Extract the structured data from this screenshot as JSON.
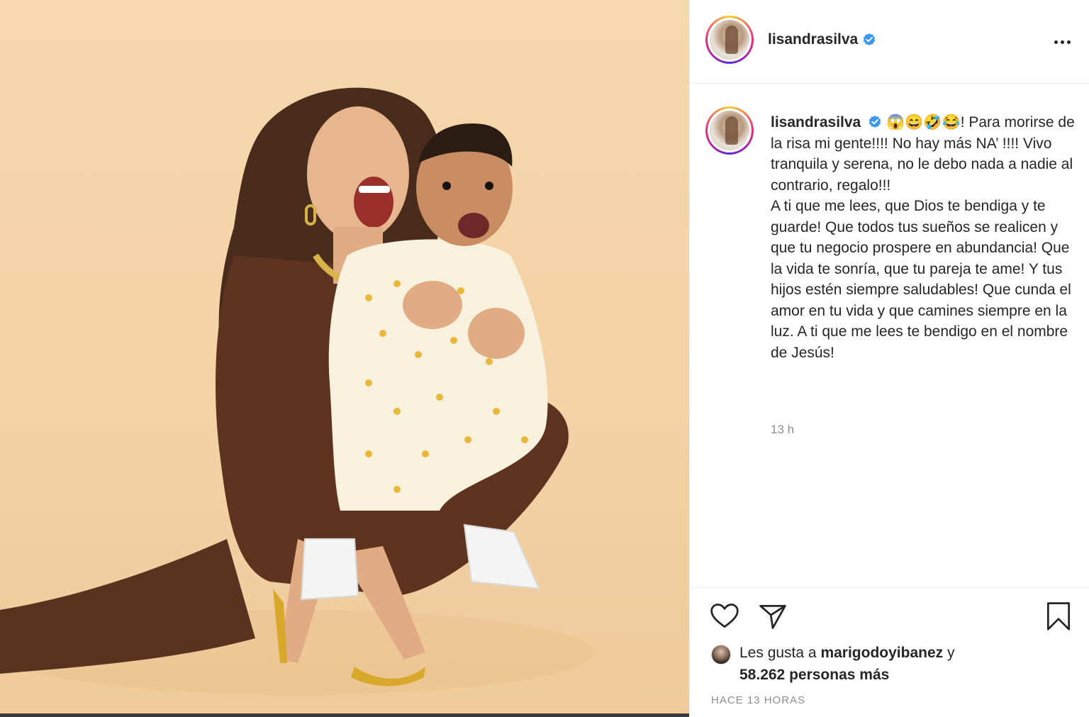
{
  "post": {
    "username": "lisandrasilva",
    "verified": true,
    "caption": {
      "emojis": "😱😄🤣😂",
      "paragraph1": "! Para morirse de la risa mi gente!!!! No hay más NA’ !!!! Vivo tranquila y serena, no le debo nada a nadie al contrario, regalo!!!",
      "paragraph2": "A ti que me lees, que Dios te bendiga y te guarde! Que todos tus sueños se realicen y que tu negocio prospere en abundancia! Que la vida te sonría, que tu pareja te ame! Y tus hijos estén siempre saludables! Que cunda el amor en tu vida y que camines siempre en la luz. A ti que me lees te bendigo en el nombre de Jesús!"
    },
    "timestamp": "13 h",
    "likes": {
      "prefix": "Les gusta a",
      "liker": "marigodoyibanez",
      "conjunction": "y",
      "others": "58.262 personas más"
    },
    "post_age": "HACE 13 HORAS"
  },
  "icons": {
    "more": "more-options-icon",
    "like": "heart-icon",
    "share": "paper-plane-icon",
    "save": "bookmark-icon",
    "verified": "verified-badge-icon"
  },
  "colors": {
    "verified_blue": "#3897f0",
    "photo_background": "#f5d5a8",
    "dress": "#5a3220",
    "muted_text": "#8e8e8e"
  }
}
